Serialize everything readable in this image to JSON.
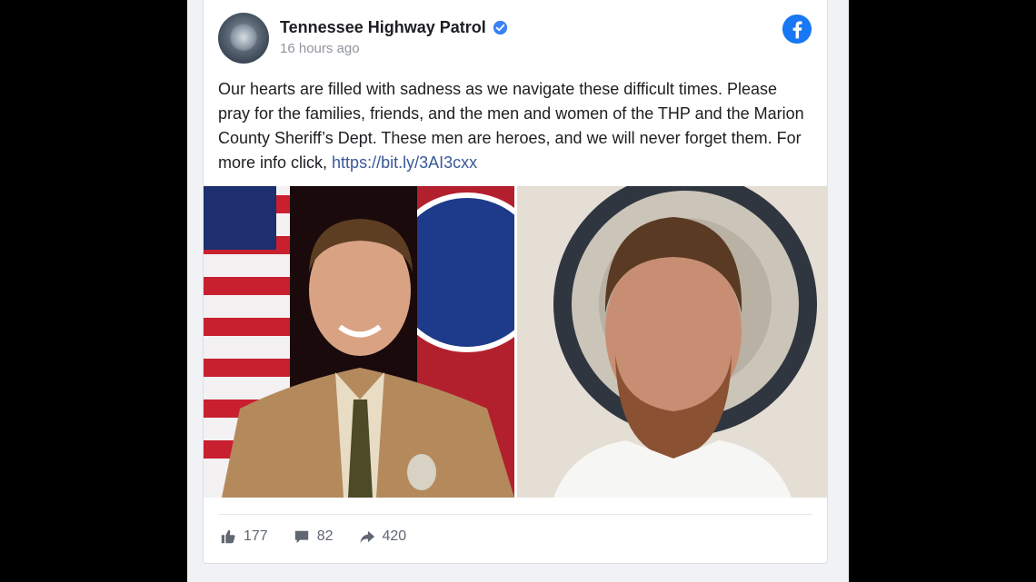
{
  "post": {
    "page_name": "Tennessee Highway Patrol",
    "timestamp": "16 hours ago",
    "text_main": "Our hearts are filled with sadness as we navigate these difficult times. Please pray for the families, friends, and the men and women of the THP and the Marion County Sheriff’s Dept. These men are heroes, and we will never forget them. For more info click, ",
    "link_text": "https://bit.ly/3AI3cxx"
  },
  "engagement": {
    "likes": "177",
    "comments": "82",
    "shares": "420"
  },
  "icons": [
    "verified-icon",
    "facebook-icon",
    "like-icon",
    "comment-icon",
    "share-icon"
  ],
  "colors": {
    "facebook_blue": "#1877f2",
    "link": "#385898",
    "text": "#1c1e21",
    "muted": "#606770"
  }
}
